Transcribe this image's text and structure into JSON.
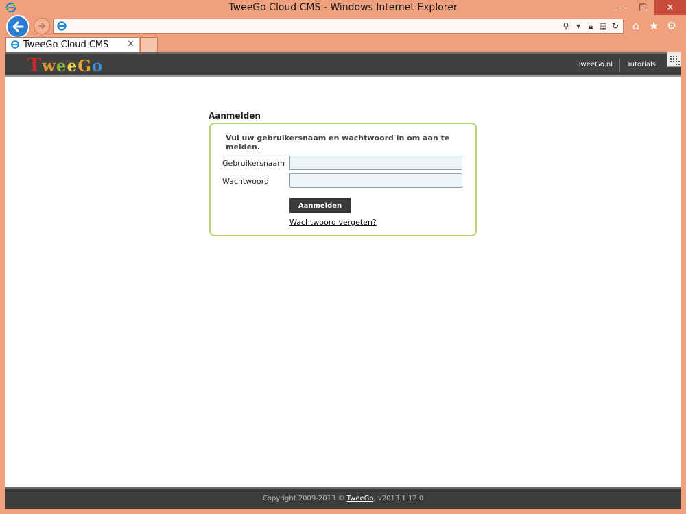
{
  "window": {
    "title": "TweeGo Cloud CMS - Windows Internet Explorer",
    "minimize": "—",
    "maximize": "☐",
    "close": "✕"
  },
  "browser": {
    "address_value": "",
    "tab_label": "TweeGo Cloud CMS",
    "tab_close": "✕",
    "icons": [
      "back-arrow-icon",
      "forward-arrow-icon",
      "ie-icon",
      "search-icon",
      "lock-icon",
      "refresh-icon",
      "home-icon",
      "star-icon",
      "gear-icon"
    ]
  },
  "site": {
    "logo_letters": [
      "T",
      "w",
      "e",
      "e",
      "G",
      "o"
    ],
    "nav": [
      "TweeGo.nl",
      "Tutorials"
    ]
  },
  "login": {
    "heading": "Aanmelden",
    "intro": "Vul uw gebruikersnaam en wachtwoord in om aan te melden.",
    "username_label": "Gebruikersnaam",
    "username_value": "",
    "password_label": "Wachtwoord",
    "password_value": "",
    "submit_label": "Aanmelden",
    "forgot_label": "Wachtwoord vergeten?"
  },
  "footer": {
    "prefix": "Copyright 2009-2013 © ",
    "link": "TweeGo",
    "suffix": ", v2013.1.12.0"
  },
  "colors": {
    "frame": "#f0a07c",
    "sitebar": "#404040",
    "login_border": "#b4d36a",
    "accent_blue": "#2b7cd3"
  }
}
